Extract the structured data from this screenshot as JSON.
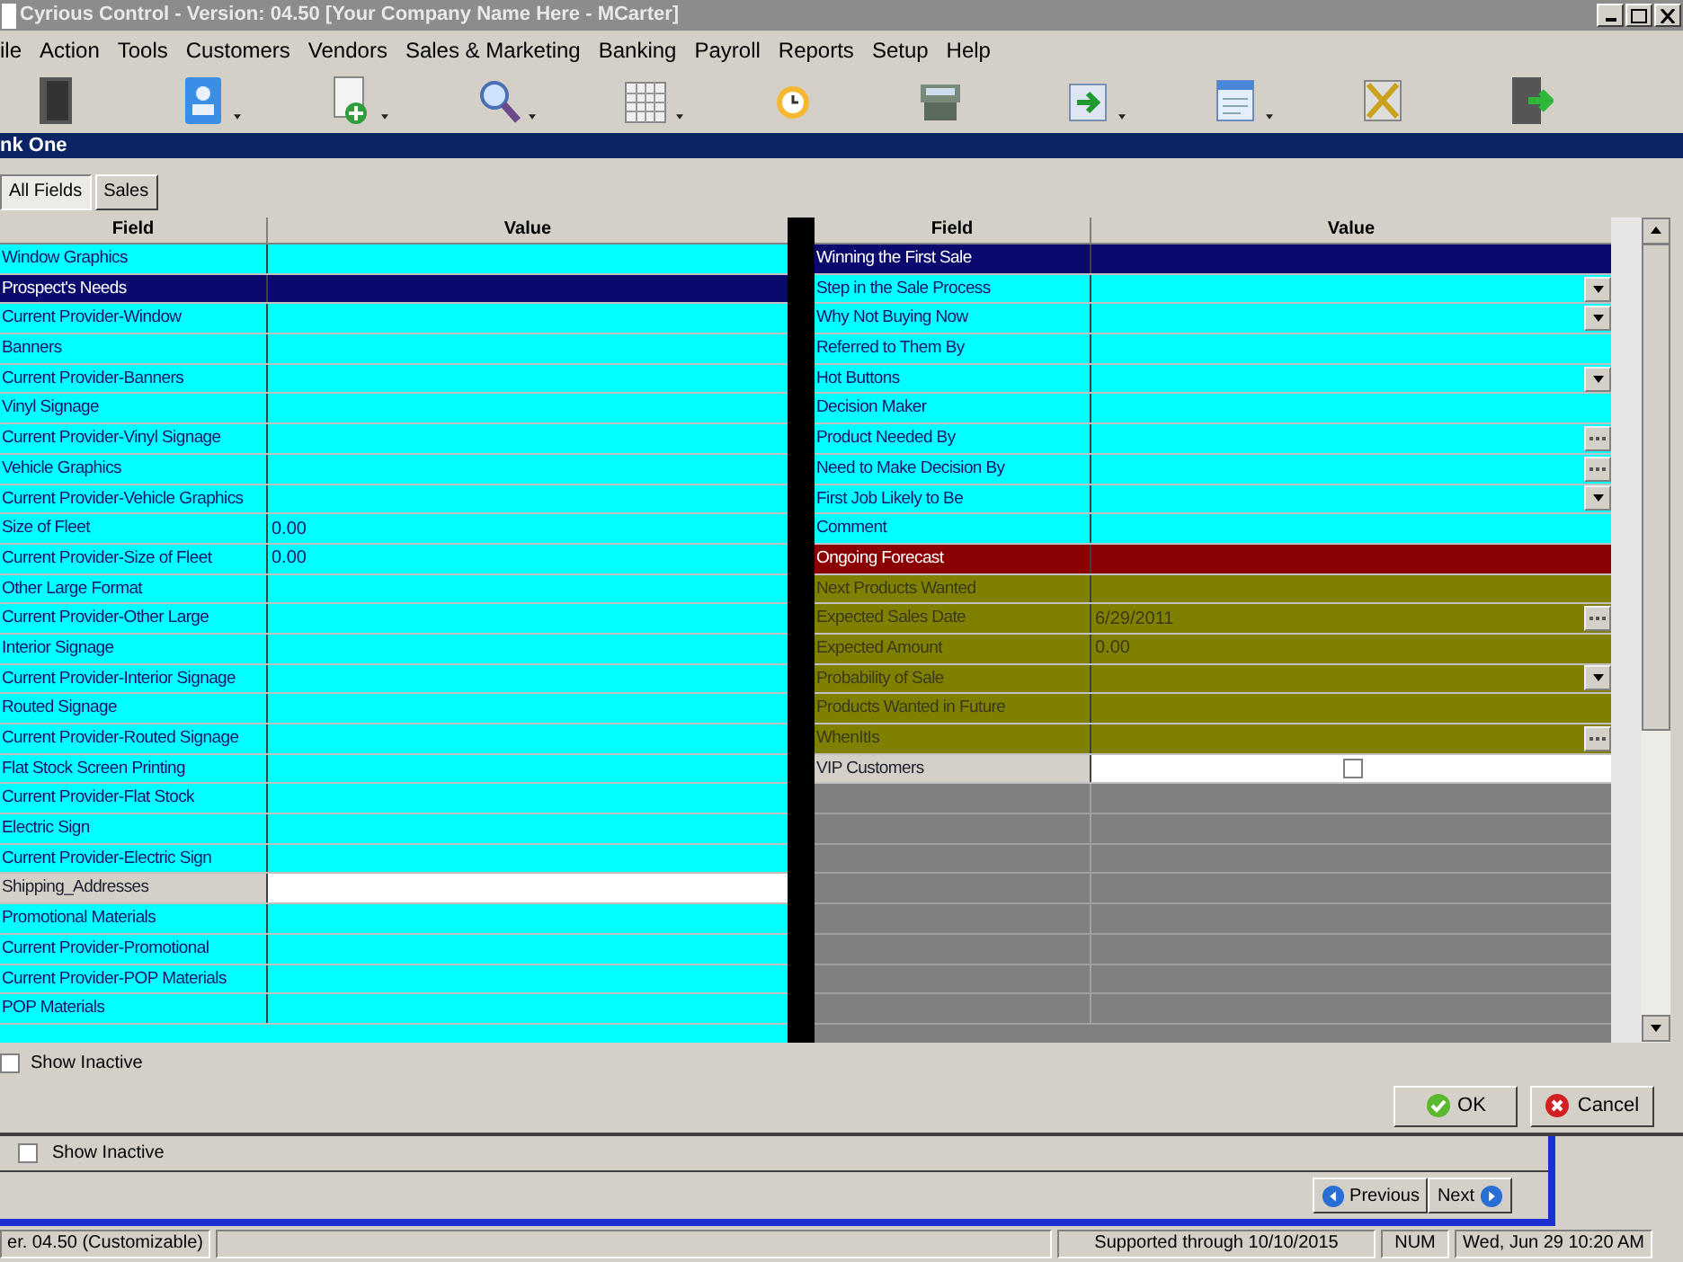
{
  "window": {
    "title": "Cyrious Control - Version: 04.50 [Your Company Name Here - MCarter]"
  },
  "menu": [
    "ile",
    "Action",
    "Tools",
    "Customers",
    "Vendors",
    "Sales & Marketing",
    "Banking",
    "Payroll",
    "Reports",
    "Setup",
    "Help"
  ],
  "toolbar": [
    {
      "kind": "door",
      "dropdown": false
    },
    {
      "kind": "contact",
      "dropdown": true
    },
    {
      "kind": "newdoc",
      "dropdown": true
    },
    {
      "kind": "search",
      "dropdown": true
    },
    {
      "kind": "calendar",
      "dropdown": true
    },
    {
      "kind": "clock",
      "dropdown": false
    },
    {
      "kind": "register",
      "dropdown": false
    },
    {
      "kind": "import",
      "dropdown": true
    },
    {
      "kind": "note",
      "dropdown": true
    },
    {
      "kind": "tools",
      "dropdown": false
    },
    {
      "kind": "exit",
      "dropdown": false
    }
  ],
  "panel_title": "nk One",
  "tabs": [
    {
      "label": "All Fields",
      "selected": true
    },
    {
      "label": "Sales",
      "selected": false
    }
  ],
  "left_grid": {
    "columns": [
      "Field",
      "Value"
    ],
    "rows": [
      {
        "kind": "field",
        "field": "Window Graphics",
        "color": "#00ffff"
      },
      {
        "kind": "group",
        "field": "Prospect's Needs",
        "color": "#0a0a6e"
      },
      {
        "kind": "field",
        "field": "Current Provider-Window",
        "color": "#00ffff"
      },
      {
        "kind": "field",
        "field": "Banners",
        "color": "#00ffff"
      },
      {
        "kind": "field",
        "field": "Current Provider-Banners",
        "color": "#00ffff"
      },
      {
        "kind": "field",
        "field": "Vinyl Signage",
        "color": "#00ffff"
      },
      {
        "kind": "field",
        "field": "Current Provider-Vinyl Signage",
        "color": "#00ffff"
      },
      {
        "kind": "field",
        "field": "Vehicle Graphics",
        "color": "#00ffff"
      },
      {
        "kind": "field",
        "field": "Current Provider-Vehicle Graphics",
        "color": "#00ffff"
      },
      {
        "kind": "field",
        "field": "Size of Fleet",
        "value": "0.00",
        "color": "#00ffff"
      },
      {
        "kind": "field",
        "field": "Current Provider-Size of Fleet",
        "value": "0.00",
        "color": "#00ffff"
      },
      {
        "kind": "field",
        "field": "Other Large Format",
        "color": "#00ffff"
      },
      {
        "kind": "field",
        "field": "Current Provider-Other Large",
        "color": "#00ffff"
      },
      {
        "kind": "field",
        "field": "Interior Signage",
        "color": "#00ffff"
      },
      {
        "kind": "field",
        "field": "Current Provider-Interior Signage",
        "color": "#00ffff"
      },
      {
        "kind": "field",
        "field": "Routed Signage",
        "color": "#00ffff"
      },
      {
        "kind": "field",
        "field": "Current Provider-Routed Signage",
        "color": "#00ffff"
      },
      {
        "kind": "field",
        "field": "Flat Stock Screen Printing",
        "color": "#00ffff"
      },
      {
        "kind": "field",
        "field": "Current Provider-Flat Stock",
        "color": "#00ffff"
      },
      {
        "kind": "field",
        "field": "Electric Sign",
        "color": "#00ffff"
      },
      {
        "kind": "field",
        "field": "Current Provider-Electric Sign",
        "color": "#00ffff"
      },
      {
        "kind": "input",
        "field": "Shipping_Addresses"
      },
      {
        "kind": "field",
        "field": "Promotional Materials",
        "color": "#00ffff"
      },
      {
        "kind": "field",
        "field": "Current Provider-Promotional",
        "color": "#00ffff"
      },
      {
        "kind": "field",
        "field": "Current Provider-POP Materials",
        "color": "#00ffff"
      },
      {
        "kind": "field",
        "field": "POP Materials",
        "color": "#00ffff"
      }
    ]
  },
  "right_grid": {
    "columns": [
      "Field",
      "Value"
    ],
    "rows": [
      {
        "kind": "group",
        "field": "Winning the First Sale",
        "color": "#0a0a6e"
      },
      {
        "kind": "field",
        "field": "Step in the Sale Process",
        "color": "#00ffff",
        "dropdown": true
      },
      {
        "kind": "field",
        "field": "Why Not Buying Now",
        "color": "#00ffff",
        "dropdown": true
      },
      {
        "kind": "field",
        "field": "Referred to Them By",
        "color": "#00ffff"
      },
      {
        "kind": "field",
        "field": "Hot Buttons",
        "color": "#00ffff",
        "dropdown": true
      },
      {
        "kind": "field",
        "field": "Decision Maker",
        "color": "#00ffff"
      },
      {
        "kind": "field",
        "field": "Product Needed By",
        "color": "#00ffff",
        "ellipsis": true
      },
      {
        "kind": "field",
        "field": "Need to Make Decision By",
        "color": "#00ffff",
        "ellipsis": true
      },
      {
        "kind": "field",
        "field": "First Job Likely to Be",
        "color": "#00ffff",
        "dropdown": true
      },
      {
        "kind": "field",
        "field": "Comment",
        "color": "#00ffff"
      },
      {
        "kind": "group",
        "field": "Ongoing Forecast",
        "color": "#8b0000"
      },
      {
        "kind": "field",
        "field": "Next Products Wanted",
        "color": "#808000"
      },
      {
        "kind": "field",
        "field": "Expected Sales Date",
        "value": "6/29/2011",
        "color": "#808000",
        "ellipsis": true
      },
      {
        "kind": "field",
        "field": "Expected Amount",
        "value": "0.00",
        "color": "#808000"
      },
      {
        "kind": "field",
        "field": "Probability of Sale",
        "color": "#808000",
        "dropdown": true
      },
      {
        "kind": "field",
        "field": "Products Wanted in Future",
        "color": "#808000"
      },
      {
        "kind": "field",
        "field": "WhenItIs",
        "color": "#808000",
        "ellipsis": true
      },
      {
        "kind": "input",
        "field": "VIP Customers",
        "checked": false
      }
    ]
  },
  "show_inactive": {
    "label": "Show Inactive",
    "checked": false
  },
  "buttons": [
    {
      "label": "OK",
      "kind": "ok"
    },
    {
      "label": "Cancel",
      "kind": "cancel"
    }
  ],
  "background_window": {
    "show_inactive": {
      "label": "Show Inactive",
      "checked": false
    },
    "buttons": [
      {
        "label": "Previous",
        "kind": "previous"
      },
      {
        "label": "Next",
        "kind": "next"
      }
    ]
  },
  "status_bar": [
    "er. 04.50 (Customizable)",
    "Supported through 10/10/2015",
    "NUM",
    "Wed, Jun 29  10:20 AM"
  ]
}
